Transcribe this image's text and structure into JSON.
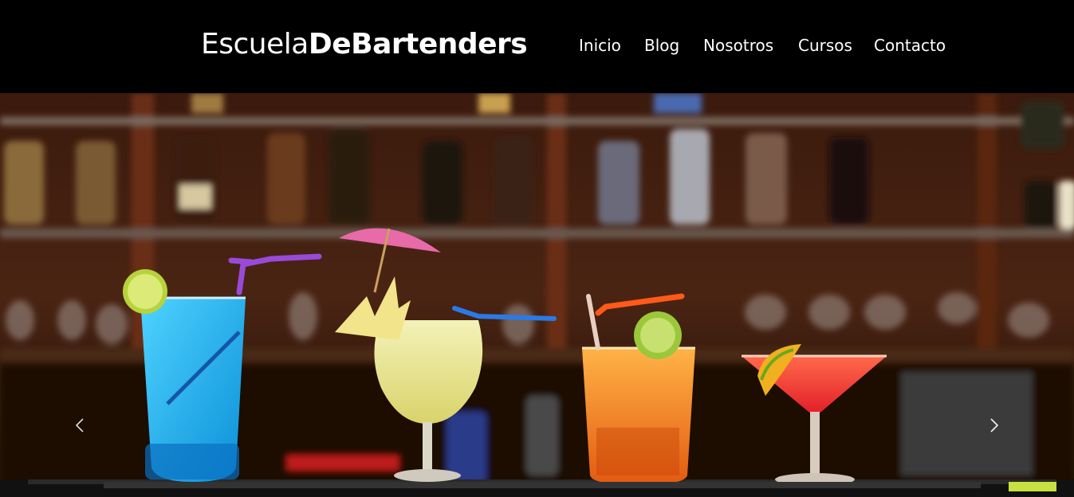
{
  "brand": {
    "light": "Escuela",
    "bold": "DeBartenders"
  },
  "nav": {
    "items": [
      {
        "label": "Inicio"
      },
      {
        "label": "Blog"
      },
      {
        "label": "Nosotros"
      },
      {
        "label": "Cursos"
      },
      {
        "label": "Contacto"
      }
    ]
  },
  "carousel": {
    "prev_icon": "chevron-left-icon",
    "next_icon": "chevron-right-icon",
    "slide_image": "cocktails-on-bar"
  },
  "colors": {
    "navbar_bg": "#000000",
    "nav_text": "#ffffff"
  }
}
